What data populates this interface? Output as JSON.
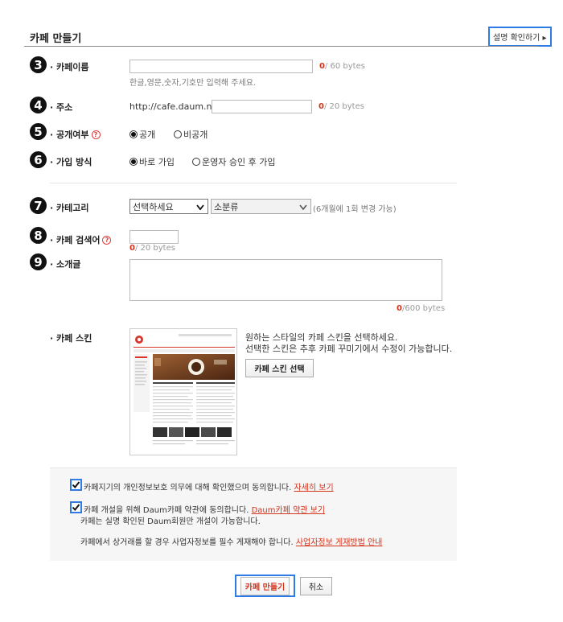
{
  "header": {
    "title": "카페 만들기",
    "guide_button": "설명 확인하기 ▸"
  },
  "fields": {
    "name": {
      "step": "3",
      "label": "· 카페이름",
      "value": "",
      "count": "0",
      "limit": "/ 60 bytes",
      "hint": "한글,영문,숫자,기호만 입력해 주세요."
    },
    "address": {
      "step": "4",
      "label": "· 주소",
      "prefix": "http://cafe.daum.net/",
      "value": "",
      "count": "0",
      "limit": "/ 20 bytes"
    },
    "visibility": {
      "step": "5",
      "label": "· 공개여부",
      "help": "?",
      "options": [
        "공개",
        "비공개"
      ],
      "selected": "공개"
    },
    "join": {
      "step": "6",
      "label": "· 가입 방식",
      "options": [
        "바로 가입",
        "운영자 승인 후 가입"
      ],
      "selected": "바로 가입"
    },
    "category": {
      "step": "7",
      "label": "· 카테고리",
      "select1": "선택하세요",
      "select2": "소분류",
      "note": "(6개월에 1회 변경 가능)"
    },
    "keyword": {
      "step": "8",
      "label": "· 카페 검색어",
      "help": "?",
      "value": "",
      "count": "0",
      "limit": "/ 20 bytes"
    },
    "intro": {
      "step": "9",
      "label": "· 소개글",
      "value": "",
      "count": "0",
      "limit": "/600 bytes"
    },
    "skin": {
      "label": "· 카페 스킨",
      "desc1": "원하는 스타일의 카페 스킨을 선택하세요.",
      "desc2": "선택한 스킨은 추후 카페 꾸미기에서 수정이 가능합니다.",
      "button": "카페 스킨 선택",
      "thumb_title": "카페놀이터",
      "thumb_cafe": "cafe",
      "thumb_subtitle": "Daum 카페"
    }
  },
  "agreements": {
    "privacy": {
      "checked": true,
      "text": "카페지기의 개인정보보호 의무에 대해 확인했으며 동의합니다.",
      "link": "자세히 보기"
    },
    "terms": {
      "checked": true,
      "text": "카페 개설을 위해 Daum카페 약관에 동의합니다.",
      "link": "Daum카페 약관 보기",
      "sub": "카페는 실명 확인된 Daum회원만 개설이 가능합니다."
    },
    "business": {
      "text": "카페에서 상거래를 할 경우 사업자정보를 필수 게재해야 합니다.",
      "link": "사업자정보 게재방법 안내"
    }
  },
  "actions": {
    "submit": "카페 만들기",
    "cancel": "취소"
  },
  "colors": {
    "accent": "#2e7be6",
    "link": "#d6331b",
    "brand_red": "#d9352b"
  }
}
